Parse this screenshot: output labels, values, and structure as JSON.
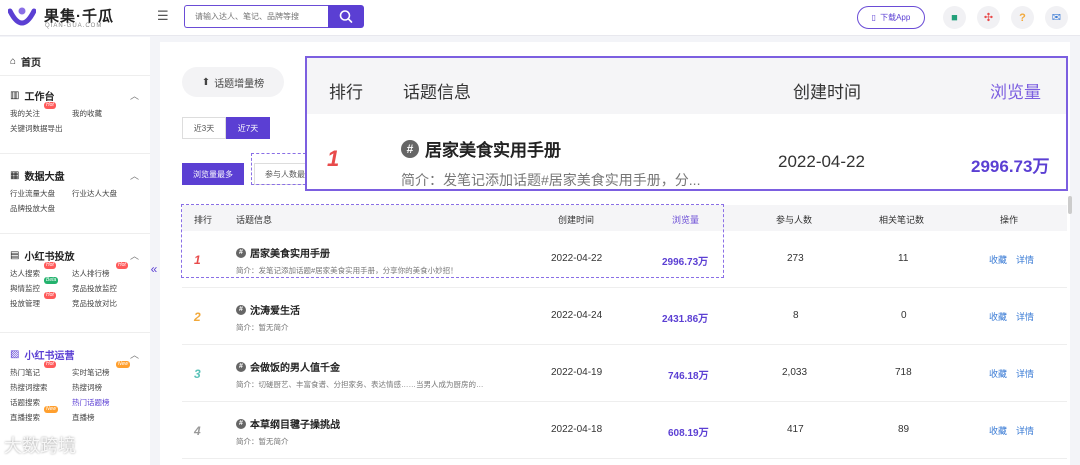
{
  "header": {
    "logo_text": "果集·千瓜",
    "logo_sub": "QIAN-GUA.COM",
    "search_placeholder": "请输入达人、笔记、品牌等搜",
    "download_label": "下载App"
  },
  "sidebar": {
    "home": "首页",
    "workbench": {
      "title": "工作台",
      "items": [
        "我的关注",
        "我的收藏",
        "关键词数据导出"
      ]
    },
    "data_board": {
      "title": "数据大盘",
      "items": [
        "行业流量大盘",
        "行业达人大盘",
        "品牌投放大盘"
      ]
    },
    "xhs_ad": {
      "title": "小红书投放",
      "items": [
        "达人搜索",
        "达人排行榜",
        "舆情监控",
        "竞品投放监控",
        "投放管理",
        "竞品投放对比"
      ]
    },
    "xhs_ops": {
      "title": "小红书运营",
      "items": [
        "热门笔记",
        "实时笔记榜",
        "热搜词搜索",
        "热搜词榜",
        "话题搜索",
        "热门话题榜",
        "直播搜索",
        "直播榜"
      ]
    },
    "badges": {
      "hot": "Hot",
      "beta": "Beta",
      "new": "New"
    }
  },
  "main": {
    "topic_tab": "话题增量榜",
    "periods": [
      "近3天",
      "近7天"
    ],
    "sorts": [
      "浏览量最多",
      "参与人数最多"
    ],
    "columns": [
      "排行",
      "话题信息",
      "创建时间",
      "浏览量",
      "参与人数",
      "相关笔记数",
      "操作"
    ],
    "actions": [
      "收藏",
      "详情"
    ],
    "rows": [
      {
        "rank": "1",
        "title": "居家美食实用手册",
        "intro": "简介：发笔记添加话题#居家美食实用手册，分享你的美食小妙招！",
        "date": "2022-04-22",
        "views": "2996.73万",
        "participants": "273",
        "notes": "11"
      },
      {
        "rank": "2",
        "title": "沈涛爱生活",
        "intro": "简介：暂无简介",
        "date": "2022-04-24",
        "views": "2431.86万",
        "participants": "8",
        "notes": "0"
      },
      {
        "rank": "3",
        "title": "会做饭的男人值千金",
        "intro": "简介：切磋厨艺、丰富食谱、分担家务、表达情感……当男人成为厨房的…",
        "date": "2022-04-19",
        "views": "746.18万",
        "participants": "2,033",
        "notes": "718"
      },
      {
        "rank": "4",
        "title": "本草纲目毽子操挑战",
        "intro": "简介：暂无简介",
        "date": "2022-04-18",
        "views": "608.19万",
        "participants": "417",
        "notes": "89"
      }
    ]
  },
  "zoom": {
    "columns": [
      "排行",
      "话题信息",
      "创建时间",
      "浏览量"
    ],
    "rank": "1",
    "title": "居家美食实用手册",
    "intro": "简介：发笔记添加话题#居家美食实用手册，分...",
    "date": "2022-04-22",
    "views": "2996.73万"
  },
  "watermark": "大数跨境",
  "colors": {
    "accent": "#5b3fd3",
    "rank1": "#e84a4a",
    "rank2": "#f2a93b",
    "rank3": "#5bc2b8",
    "rank4": "#999999",
    "link": "#3a7bd5"
  }
}
